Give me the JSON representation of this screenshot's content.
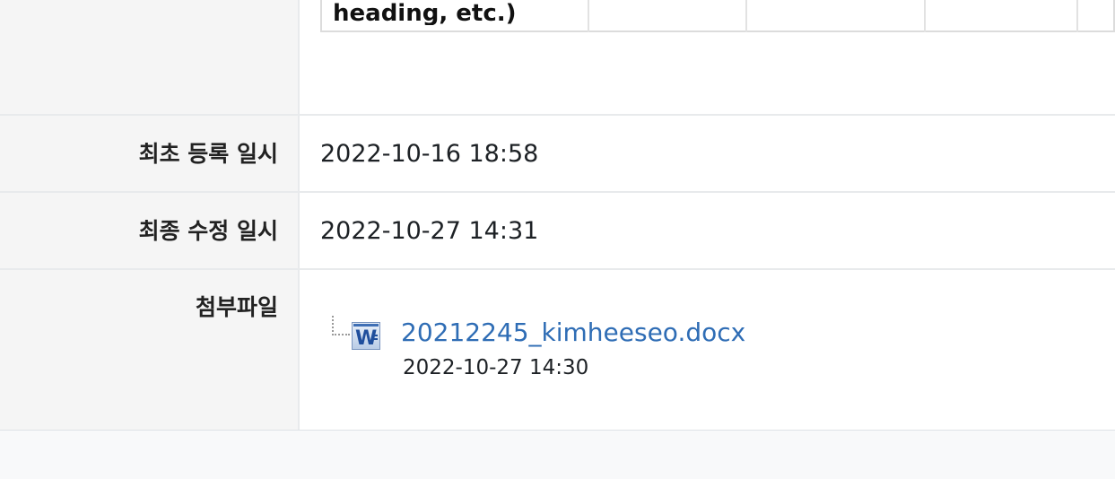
{
  "summary": {
    "table_fragment": {
      "first_cell": "heading, etc.)",
      "cells": [
        "",
        "",
        "",
        "",
        ""
      ]
    }
  },
  "rows": {
    "created": {
      "label": "최초 등록 일시",
      "value": "2022-10-16 18:58"
    },
    "modified": {
      "label": "최종 수정 일시",
      "value": "2022-10-27 14:31"
    },
    "attachment": {
      "label": "첨부파일",
      "file_name": "20212245_kimheeseo.docx",
      "file_date": "2022-10-27 14:30",
      "file_icon": "word-document-icon"
    }
  },
  "colors": {
    "label_bg": "#f5f5f5",
    "link": "#2f6db5",
    "word_blue": "#2b5797"
  }
}
